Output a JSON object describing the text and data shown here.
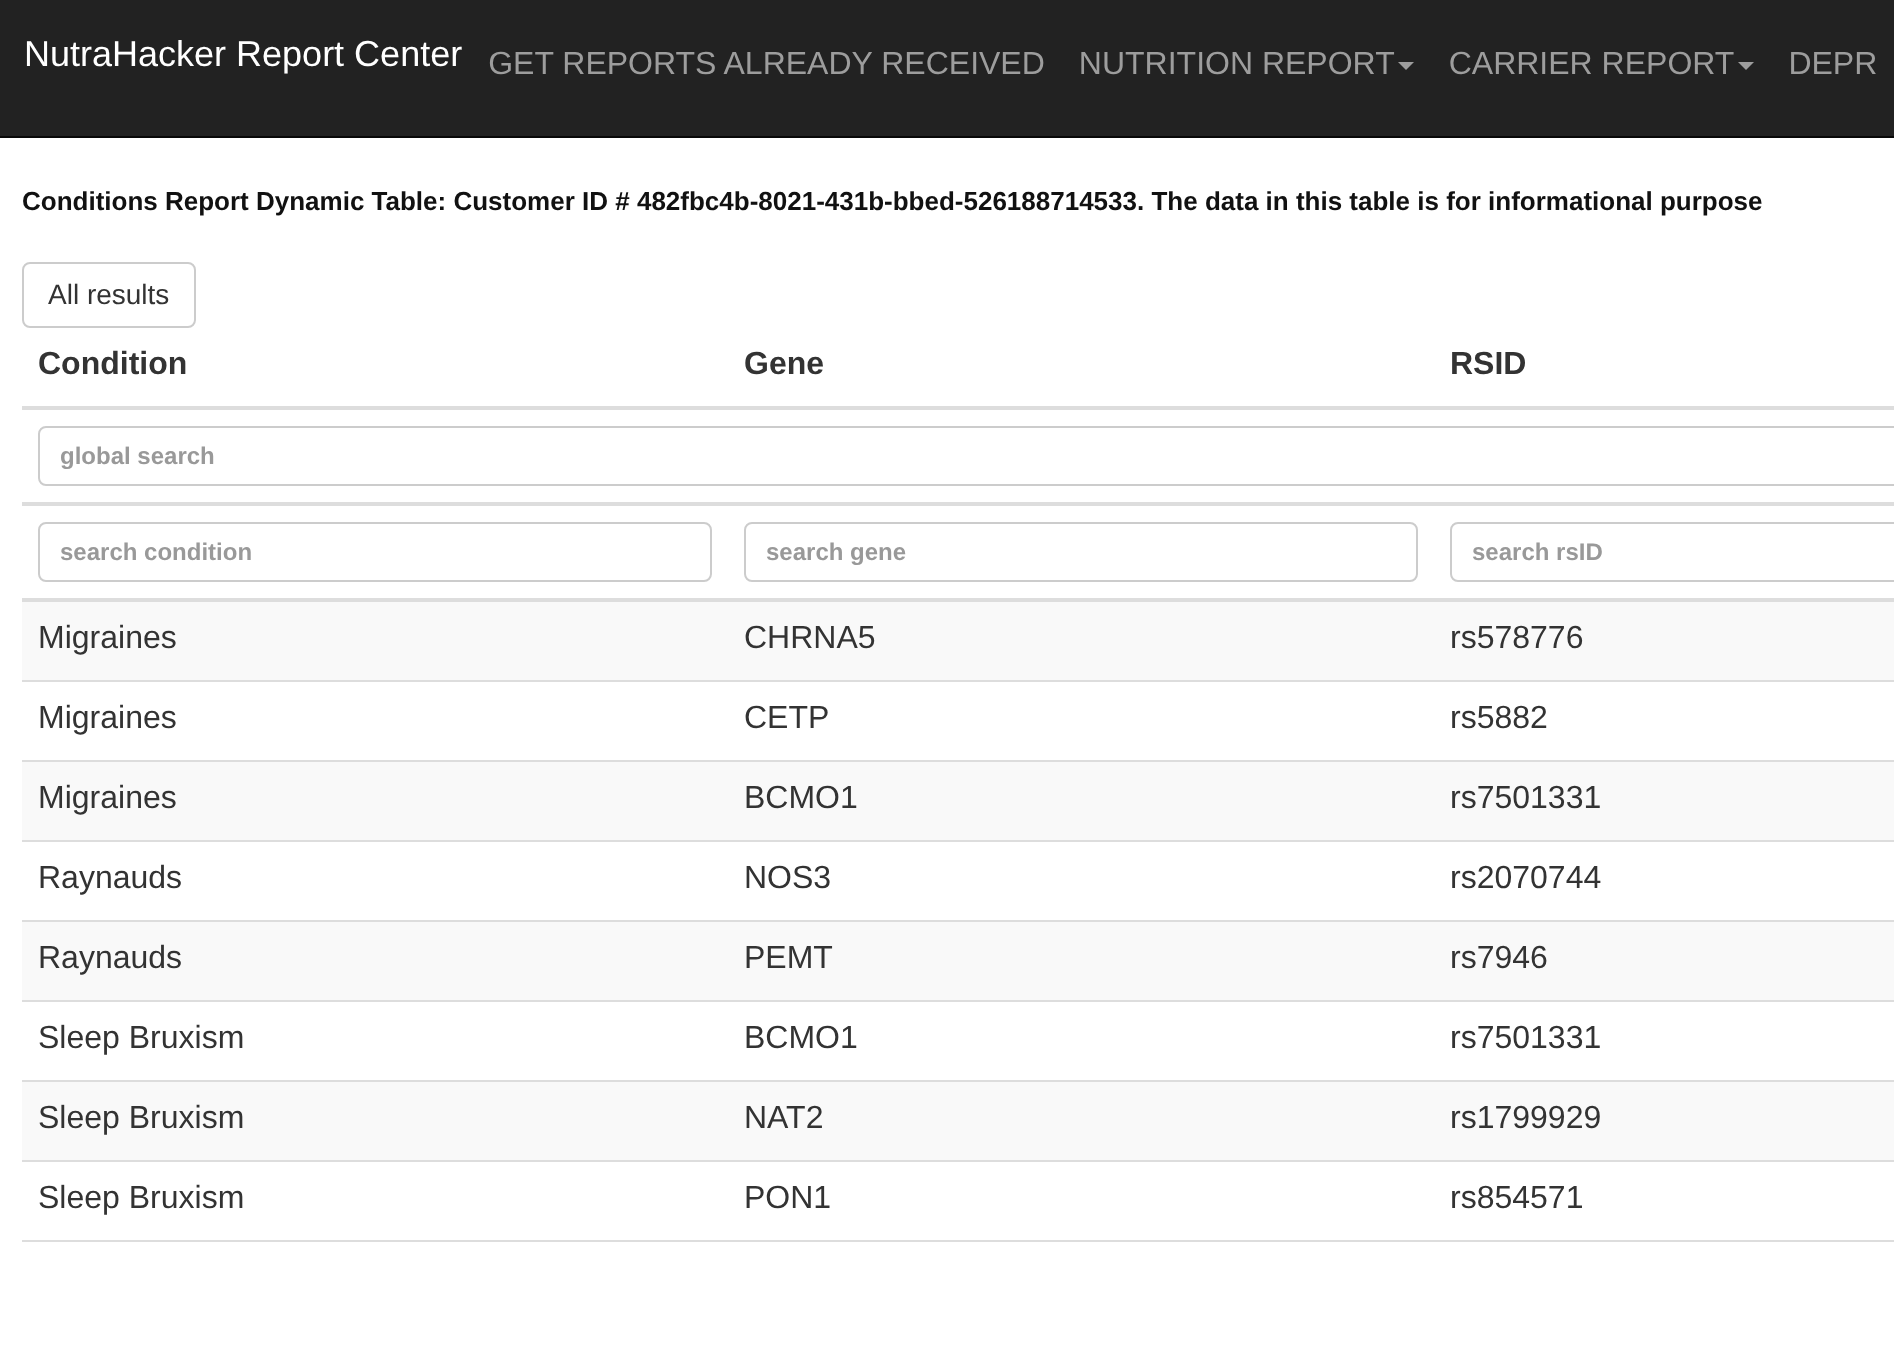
{
  "navbar": {
    "brand": "NutraHacker Report Center",
    "items": [
      {
        "label": "GET REPORTS ALREADY RECEIVED",
        "dropdown": false
      },
      {
        "label": "NUTRITION REPORT",
        "dropdown": true
      },
      {
        "label": "CARRIER REPORT",
        "dropdown": true
      },
      {
        "label": "DEPR",
        "dropdown": false
      }
    ]
  },
  "heading": "Conditions Report Dynamic Table: Customer ID # 482fbc4b-8021-431b-bbed-526188714533. The data in this table is for informational purpose",
  "all_results_button": "All results",
  "table": {
    "columns": [
      "Condition",
      "Gene",
      "RSID"
    ],
    "global_search": {
      "placeholder": "global search"
    },
    "column_search": [
      {
        "placeholder": "search condition"
      },
      {
        "placeholder": "search gene"
      },
      {
        "placeholder": "search rsID"
      }
    ],
    "rows": [
      [
        "Migraines",
        "CHRNA5",
        "rs578776"
      ],
      [
        "Migraines",
        "CETP",
        "rs5882"
      ],
      [
        "Migraines",
        "BCMO1",
        "rs7501331"
      ],
      [
        "Raynauds",
        "NOS3",
        "rs2070744"
      ],
      [
        "Raynauds",
        "PEMT",
        "rs7946"
      ],
      [
        "Sleep Bruxism",
        "BCMO1",
        "rs7501331"
      ],
      [
        "Sleep Bruxism",
        "NAT2",
        "rs1799929"
      ],
      [
        "Sleep Bruxism",
        "PON1",
        "rs854571"
      ]
    ]
  }
}
